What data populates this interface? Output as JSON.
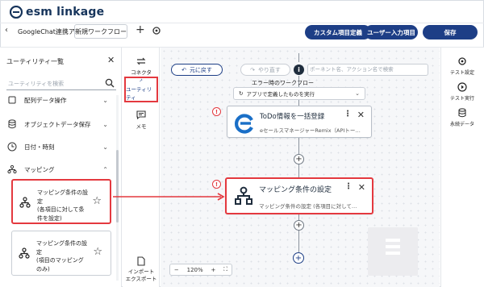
{
  "brand": {
    "name": "esm linkage"
  },
  "header": {
    "app_name": "GoogleChat連携アプリ",
    "flow_tab": "新規ワークフロー",
    "plus": "+",
    "buttons": {
      "custom_fields": "カスタム項目定義",
      "user_input": "ユーザー入力項目",
      "save": "保存"
    }
  },
  "utility_panel": {
    "title": "ユーティリティ一覧",
    "search_placeholder": "ユーティリティを検索",
    "categories": [
      {
        "label": "配列データ操作",
        "icon": "list-icon",
        "chevron": "⌄"
      },
      {
        "label": "オブジェクトデータ保存",
        "icon": "database-icon",
        "chevron": "⌄"
      },
      {
        "label": "日付・時刻",
        "icon": "clock-icon",
        "chevron": "⌄"
      },
      {
        "label": "マッピング",
        "icon": "mapping-icon",
        "chevron": "⌃"
      }
    ],
    "cards": [
      {
        "text": "マッピング条件の設定(各項目に対して条件を設定)",
        "lines": [
          "マッピング条件の設",
          "定",
          "(各項目に対して条",
          "件を設定)"
        ]
      },
      {
        "text": "マッピング条件の設定(項目のマッピングのみ)",
        "lines": [
          "マッピング条件の設",
          "定",
          "(項目のマッピング",
          "のみ)"
        ]
      }
    ]
  },
  "rail": {
    "connector": "コネクタ",
    "utility": "ユーティリティ",
    "memo": "メモ",
    "import_line1": "インポート",
    "import_line2": "エクスポート"
  },
  "canvas": {
    "undo": "元に戻す",
    "redo": "やり直す",
    "info": "i",
    "search_placeholder": "ポーネント名、アクション名で検索",
    "error_label": "エラー時のワークフロー",
    "error_select": "アプリで定義したものを実行",
    "nodes": [
      {
        "title": "ToDo情報を一括登録",
        "subtitle": "eセールスマネージャーRemix（APIトークン…"
      },
      {
        "title": "マッピング条件の設定",
        "subtitle": "マッピング条件の設定 (各項目に対して条件…"
      }
    ],
    "warn": "!",
    "zoom": {
      "minus": "−",
      "level": "120%",
      "plus": "+"
    }
  },
  "right_rail": {
    "test_settings": "テスト設定",
    "test_run": "テスト実行",
    "persistent_data": "永続データ"
  },
  "colors": {
    "primary": "#1d3e86",
    "highlight": "#e4393f",
    "brand_text": "#16345b"
  }
}
